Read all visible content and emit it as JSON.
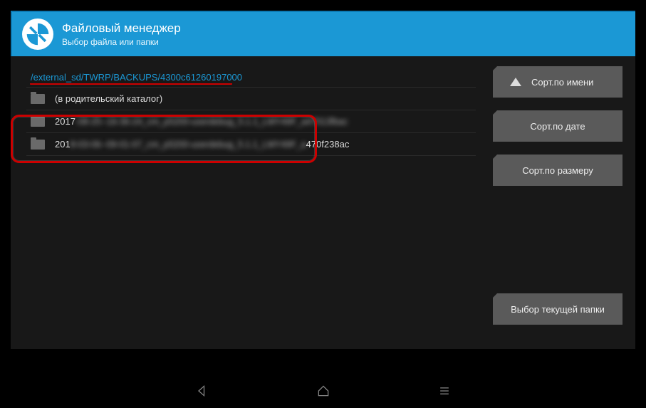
{
  "header": {
    "title": "Файловый менеджер",
    "subtitle": "Выбор файла или папки"
  },
  "path": "/external_sd/TWRP/BACKUPS/4300c61260197000",
  "list": {
    "parent_label": "(в родительский каталог)",
    "items": [
      {
        "prefix": "2017",
        "blurred": "-08-25--16-36-24_cm_p5200-userdebug_5.1.1_LMY49F_a47013fbac"
      },
      {
        "prefix": "201",
        "blurred": "8-03-06--09-01-07_cm_p5200-userdebug_5.1.1_LMY49F_a",
        "tail": "470f238ac"
      }
    ]
  },
  "buttons": {
    "sort_name": "Сорт.по имени",
    "sort_date": "Сорт.по дате",
    "sort_size": "Сорт.по размеру",
    "select_folder": "Выбор текущей папки"
  }
}
